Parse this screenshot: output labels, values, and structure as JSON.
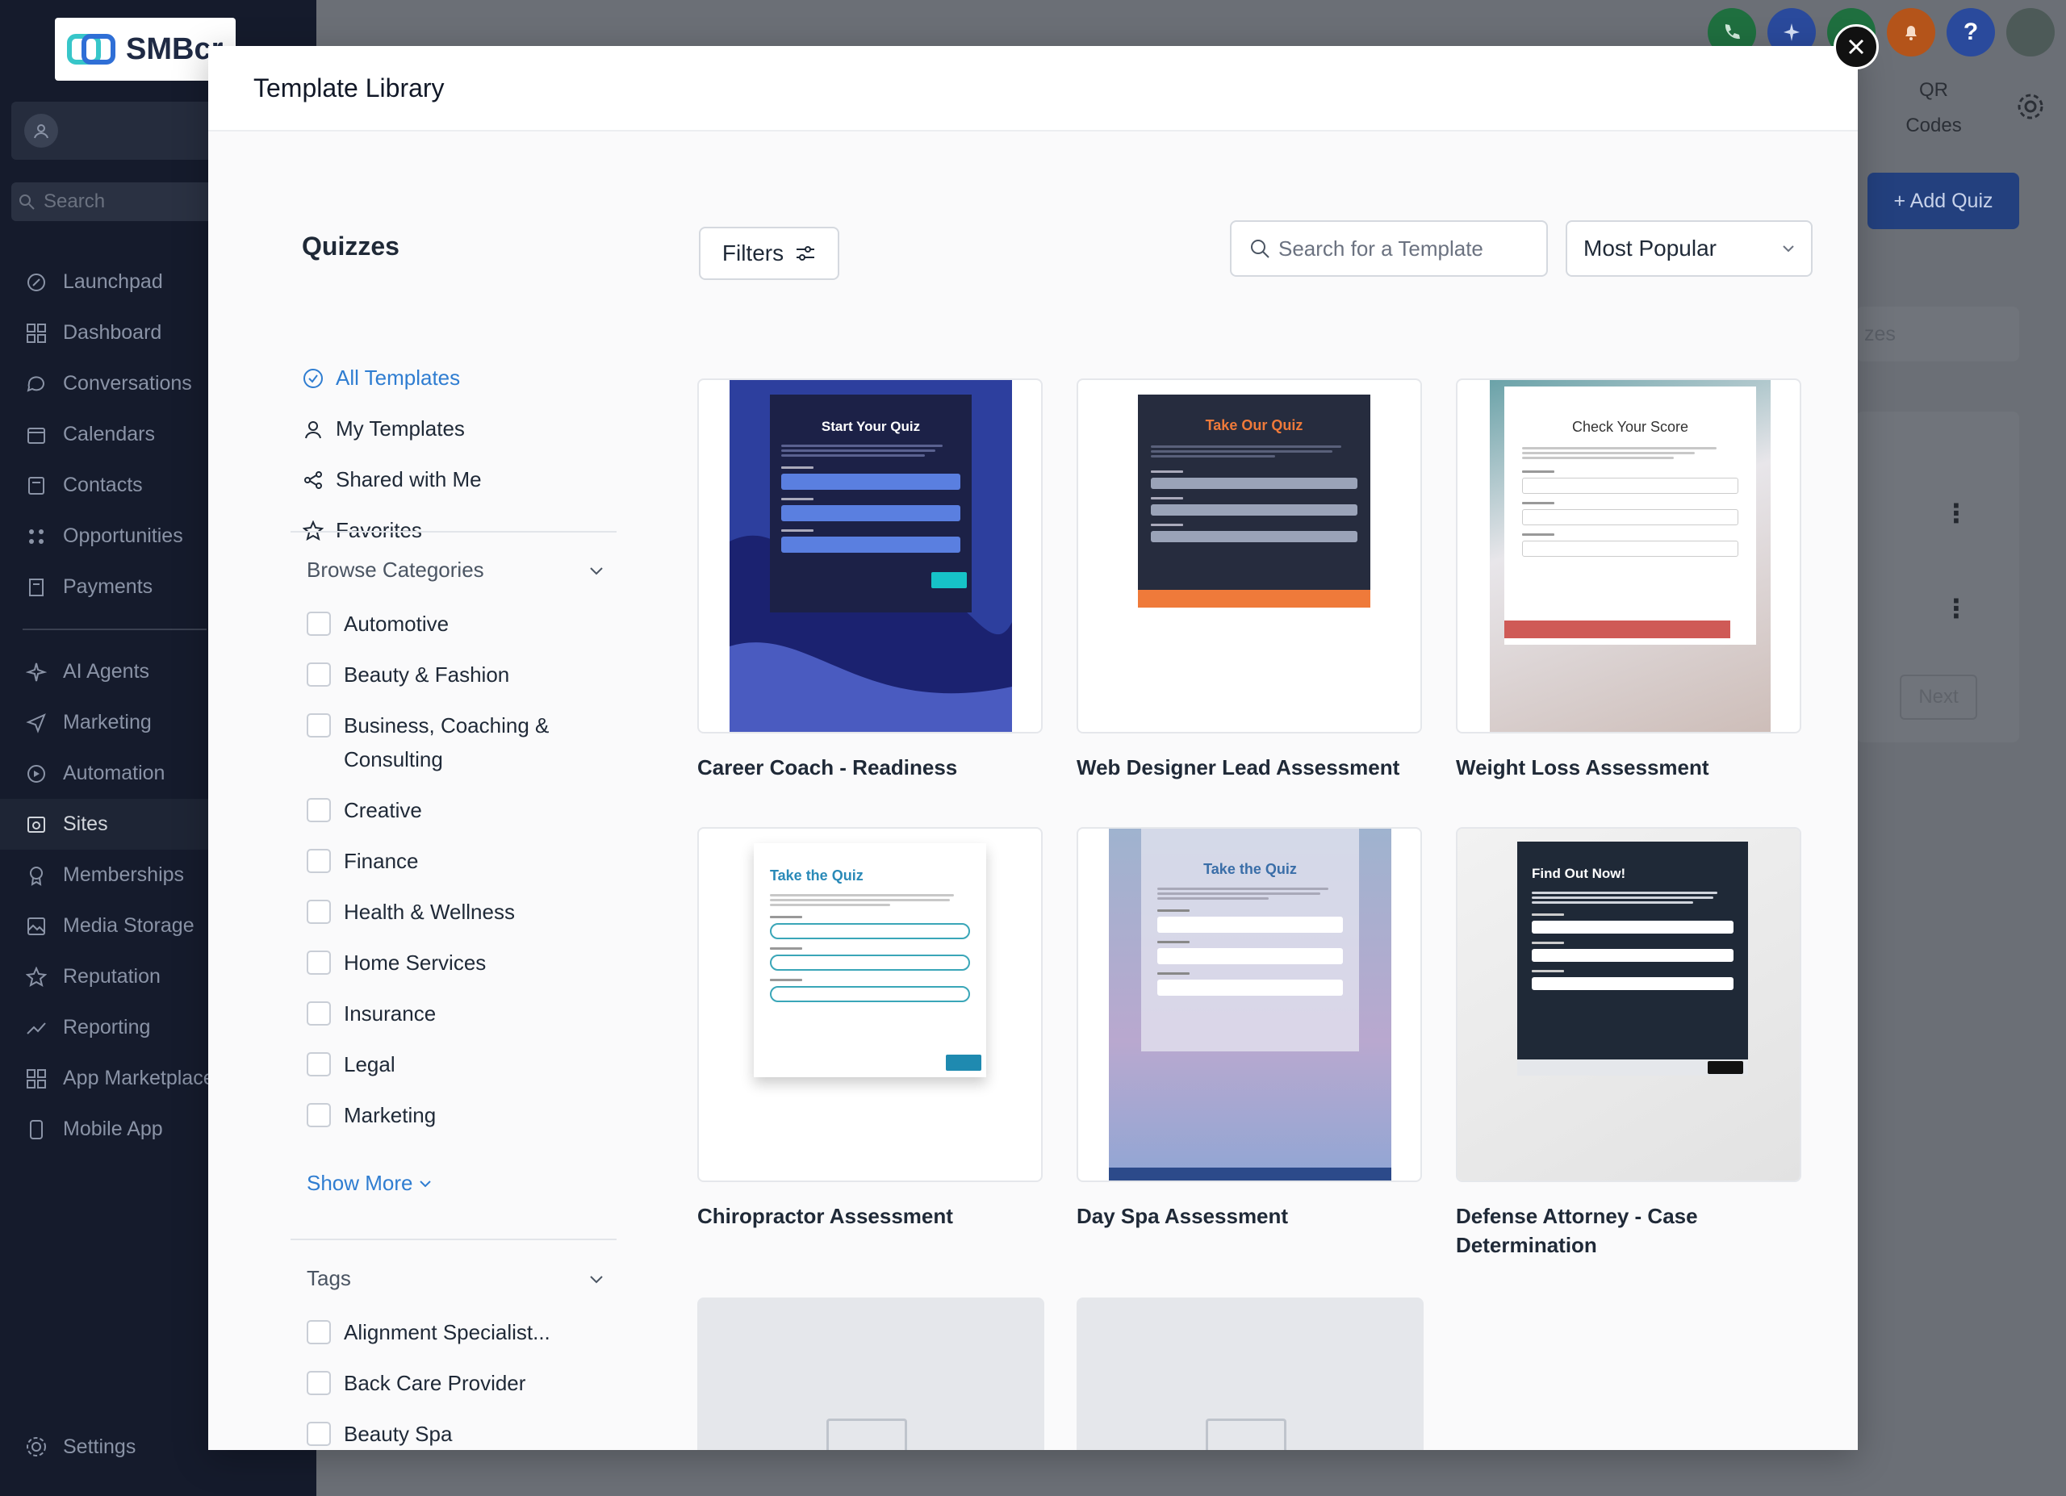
{
  "app": {
    "logo_text": "SMBcr",
    "sidebar_search_placeholder": "Search",
    "nav": [
      {
        "label": "Launchpad",
        "icon": "rocket-icon"
      },
      {
        "label": "Dashboard",
        "icon": "grid-icon"
      },
      {
        "label": "Conversations",
        "icon": "chat-icon"
      },
      {
        "label": "Calendars",
        "icon": "calendar-icon"
      },
      {
        "label": "Contacts",
        "icon": "contacts-icon"
      },
      {
        "label": "Opportunities",
        "icon": "funnel-icon"
      },
      {
        "label": "Payments",
        "icon": "receipt-icon"
      }
    ],
    "nav2": [
      {
        "label": "AI Agents",
        "icon": "sparkle-icon"
      },
      {
        "label": "Marketing",
        "icon": "send-icon"
      },
      {
        "label": "Automation",
        "icon": "automation-icon"
      },
      {
        "label": "Sites",
        "icon": "globe-icon",
        "active": true
      },
      {
        "label": "Memberships",
        "icon": "award-icon"
      },
      {
        "label": "Media Storage",
        "icon": "image-icon"
      },
      {
        "label": "Reputation",
        "icon": "star-icon"
      },
      {
        "label": "Reporting",
        "icon": "trend-icon"
      },
      {
        "label": "App Marketplace",
        "icon": "apps-icon"
      },
      {
        "label": "Mobile App",
        "icon": "phone-icon"
      }
    ],
    "settings_label": "Settings",
    "qr_codes_label": [
      "QR",
      "Codes"
    ],
    "add_quiz_label": "+ Add Quiz",
    "bg_tab_fragment": "zes",
    "bg_next_label": "Next"
  },
  "modal": {
    "title": "Template Library",
    "heading": "Quizzes",
    "links": [
      {
        "label": "All Templates",
        "icon": "check-circle-icon",
        "active": true
      },
      {
        "label": "My Templates",
        "icon": "user-icon"
      },
      {
        "label": "Shared with Me",
        "icon": "share-icon"
      },
      {
        "label": "Favorites",
        "icon": "star-icon"
      }
    ],
    "categories_label": "Browse Categories",
    "categories": [
      "Automotive",
      "Beauty & Fashion",
      "Business, Coaching & Consulting",
      "Creative",
      "Finance",
      "Health & Wellness",
      "Home Services",
      "Insurance",
      "Legal",
      "Marketing"
    ],
    "show_more_label": "Show More",
    "tags_label": "Tags",
    "tags": [
      "Alignment Specialist...",
      "Back Care Provider",
      "Beauty Spa"
    ],
    "filters_label": "Filters",
    "search_placeholder": "Search for a Template",
    "sort_value": "Most Popular",
    "templates": [
      {
        "title": "Career Coach - Readiness",
        "preview_heading": "Start Your Quiz"
      },
      {
        "title": "Web Designer Lead Assessment",
        "preview_heading": "Take Our Quiz"
      },
      {
        "title": "Weight Loss Assessment",
        "preview_heading": "Check Your Score"
      },
      {
        "title": "Chiropractor Assessment",
        "preview_heading": "Take the Quiz"
      },
      {
        "title": "Day Spa Assessment",
        "preview_heading": "Take the Quiz"
      },
      {
        "title": "Defense Attorney - Case Determination",
        "preview_heading": "Find Out Now!"
      }
    ]
  },
  "colors": {
    "accent_blue": "#2f7dd1",
    "sidebar_bg": "#151b2c",
    "modal_bg": "#fafafb"
  }
}
